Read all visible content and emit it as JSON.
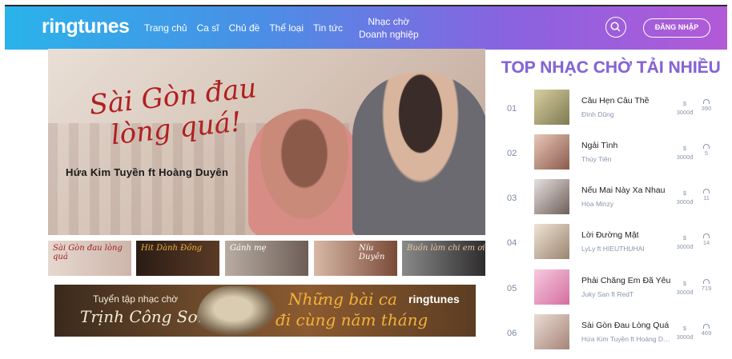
{
  "header": {
    "logo": "ringtunes",
    "nav": [
      "Trang chủ",
      "Ca sĩ",
      "Chủ đề",
      "Thể loại",
      "Tin tức"
    ],
    "nav_two_line": [
      "Nhạc chờ",
      "Doanh nghiệp"
    ],
    "login_label": "ĐĂNG NHẬP",
    "icons": {
      "search": "search-icon"
    }
  },
  "hero": {
    "title": "Sài Gòn đau lòng quá!",
    "artist": "Hứa Kim Tuyền ft Hoàng Duyên"
  },
  "thumbs": [
    {
      "caption": "Sài Gòn đau lòng quá",
      "color": "#cdb5aa"
    },
    {
      "caption": "Hit Dành Đồng",
      "color": "#5a3a26"
    },
    {
      "caption": "Gánh mẹ",
      "color": "#8c7a70"
    },
    {
      "caption": "Níu Duyên",
      "color": "#7a4a38"
    },
    {
      "caption": "Buồn làm chi em ơi",
      "color": "#3a3838"
    }
  ],
  "banner": {
    "left_line1": "Tuyển tập nhạc chờ",
    "left_line2": "Trịnh Công Sơn",
    "right_line1": "Những bài ca",
    "right_line2": "đi cùng năm tháng",
    "logo": "ringtunes"
  },
  "sidebar": {
    "title": "TOP NHẠC CHỜ TẢI NHIỀU",
    "currency_symbol": "$",
    "items": [
      {
        "rank": "01",
        "song": "Câu Hẹn Câu Thề",
        "artist": "Đình Dũng",
        "price": "3000đ",
        "downloads": "390",
        "color": "#a9a070"
      },
      {
        "rank": "02",
        "song": "Ngải Tình",
        "artist": "Thùy Tiên",
        "price": "3000đ",
        "downloads": "5",
        "color": "#c99a8a"
      },
      {
        "rank": "03",
        "song": "Nếu Mai Này Xa Nhau",
        "artist": "Hòa Minzy",
        "price": "3000đ",
        "downloads": "11",
        "color": "#b8a8a4"
      },
      {
        "rank": "04",
        "song": "Lời Đường Mật",
        "artist": "LyLy ft HIEUTHUHAI",
        "price": "3000đ",
        "downloads": "14",
        "color": "#c7b6a2"
      },
      {
        "rank": "05",
        "song": "Phải Chăng Em Đã Yêu",
        "artist": "Juky San ft RedT",
        "price": "3000đ",
        "downloads": "719",
        "color": "#e9a7c4"
      },
      {
        "rank": "06",
        "song": "Sài Gòn Đau Lòng Quá",
        "artist": "Hứa Kim Tuyền ft Hoàng Duyên",
        "price": "3000đ",
        "downloads": "469",
        "color": "#d2b7ae"
      }
    ]
  }
}
